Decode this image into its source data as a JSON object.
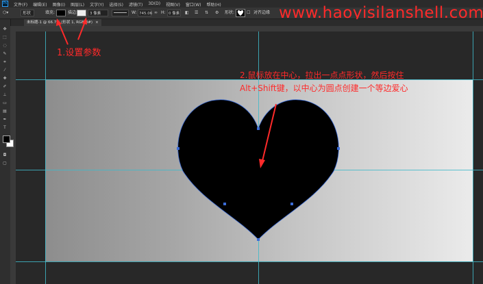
{
  "app": {
    "logo": "Ps",
    "menu": [
      "文件(F)",
      "编辑(E)",
      "图像(I)",
      "图层(L)",
      "文字(Y)",
      "选择(S)",
      "滤镜(T)",
      "3D(D)",
      "视图(V)",
      "窗口(W)",
      "帮助(H)"
    ]
  },
  "options_bar": {
    "shape_mode": "形状",
    "fill_label": "填充:",
    "stroke_label": "描边:",
    "stroke_width": "3 像素",
    "w_label": "W:",
    "w_value": "745.06",
    "h_label": "H:",
    "h_value": "0 像素",
    "align_edges_label": "对齐边缘",
    "fill_color": "#000000",
    "stroke_color": "#ffffff"
  },
  "watermark": "www.haoyisilanshell.com",
  "document_tab": {
    "title": "未标题-1 @ 66.7% (形状 1, RGB/8#)",
    "close": "×"
  },
  "annotations": {
    "step1": "1.设置参数",
    "step2_line1": "2.鼠标放在中心，拉出一点点形状，然后按住",
    "step2_line2": "Alt+Shift键，以中心为圆点创建一个等边爱心",
    "color": "#ff2a2a"
  },
  "colors": {
    "foreground": "#000000",
    "background": "#ffffff",
    "guide": "#3fb9c9",
    "anchor": "#3a6bd6"
  }
}
